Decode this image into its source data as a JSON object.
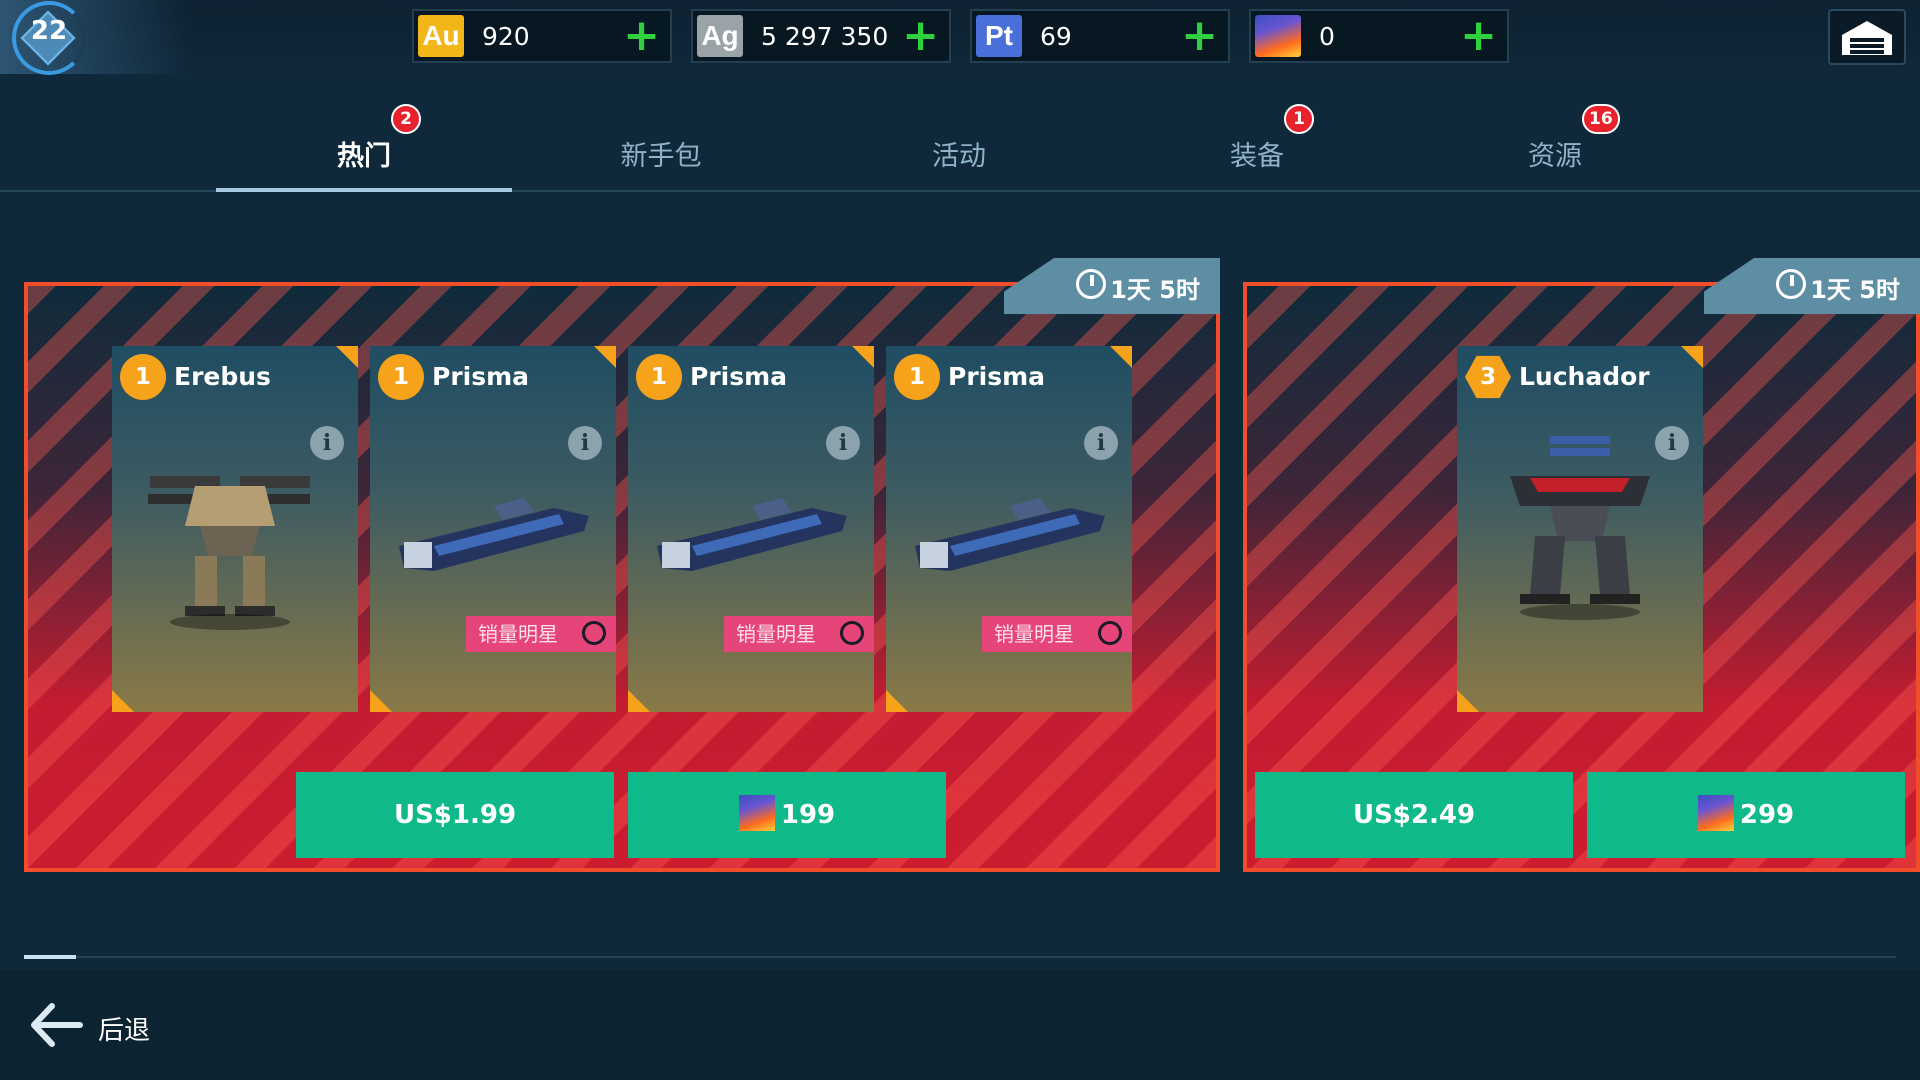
{
  "header": {
    "level": "22",
    "currencies": [
      {
        "code": "Au",
        "value": "920",
        "icon": "gold-icon",
        "color": "#f3b619"
      },
      {
        "code": "Ag",
        "value": "5 297 350",
        "icon": "silver-icon",
        "color": "#9aa3a8"
      },
      {
        "code": "Pt",
        "value": "69",
        "icon": "platinum-icon",
        "color": "#4a6fd8"
      },
      {
        "code": "",
        "value": "0",
        "icon": "key-gem-icon",
        "color": "#6a55d0"
      }
    ],
    "plus_symbol": "+",
    "garage_icon": "garage-icon"
  },
  "tabs": [
    {
      "label": "热门",
      "badge": "2",
      "active": true
    },
    {
      "label": "新手包",
      "badge": ""
    },
    {
      "label": "活动",
      "badge": ""
    },
    {
      "label": "装备",
      "badge": "1"
    },
    {
      "label": "资源",
      "badge": "16"
    }
  ],
  "offers": [
    {
      "timer": "1天 5时",
      "items": [
        {
          "tier": "1",
          "name": "Erebus",
          "badge": "",
          "type": "robot"
        },
        {
          "tier": "1",
          "name": "Prisma",
          "badge": "销量明星",
          "type": "weapon"
        },
        {
          "tier": "1",
          "name": "Prisma",
          "badge": "销量明星",
          "type": "weapon"
        },
        {
          "tier": "1",
          "name": "Prisma",
          "badge": "销量明星",
          "type": "weapon"
        }
      ],
      "price_usd": "US$1.99",
      "price_gems": "199"
    },
    {
      "timer": "1天 5时",
      "items": [
        {
          "tier": "3",
          "name": "Luchador",
          "badge": "",
          "type": "robot"
        }
      ],
      "price_usd": "US$2.49",
      "price_gems": "299"
    }
  ],
  "colors": {
    "accent_green": "#10b98a",
    "offer_border": "#f04d2b",
    "tier_orange": "#f6a21b",
    "badge_red": "#e8222d",
    "bestseller_pink": "#e6457a"
  },
  "footer": {
    "back_label": "后退",
    "back_icon": "back-arrow-icon"
  }
}
